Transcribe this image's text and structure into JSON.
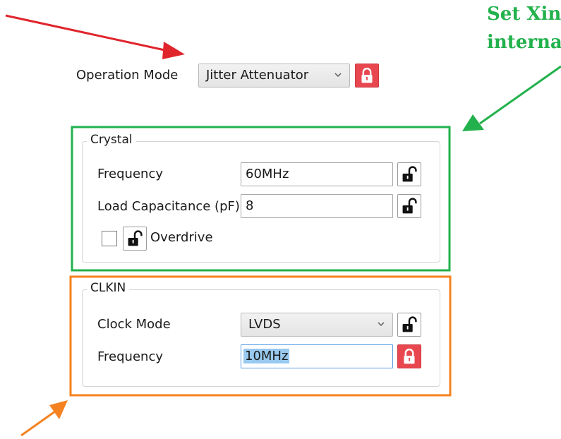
{
  "operation_mode": {
    "label": "Operation Mode",
    "value": "Jitter Attenuator",
    "locked": true
  },
  "crystal": {
    "title": "Crystal",
    "frequency_label": "Frequency",
    "frequency_value": "60MHz",
    "load_cap_label": "Load Capacitance (pF)",
    "load_cap_value": "8",
    "overdrive_label": "Overdrive",
    "overdrive_checked": false
  },
  "clkin": {
    "title": "CLKIN",
    "clock_mode_label": "Clock Mode",
    "clock_mode_value": "LVDS",
    "frequency_label": "Frequency",
    "frequency_value": "10MHz",
    "frequency_locked": true
  },
  "annotation": {
    "line1": "Set Xin",
    "line2": "interna"
  },
  "colors": {
    "red_arrow": "#e0252d",
    "green_accent": "#22b14c",
    "orange_accent": "#f58220",
    "lock_red": "#e8474f"
  },
  "icons": [
    "lock-open-icon",
    "lock-closed-icon",
    "chevron-down-icon",
    "arrow-icon"
  ]
}
